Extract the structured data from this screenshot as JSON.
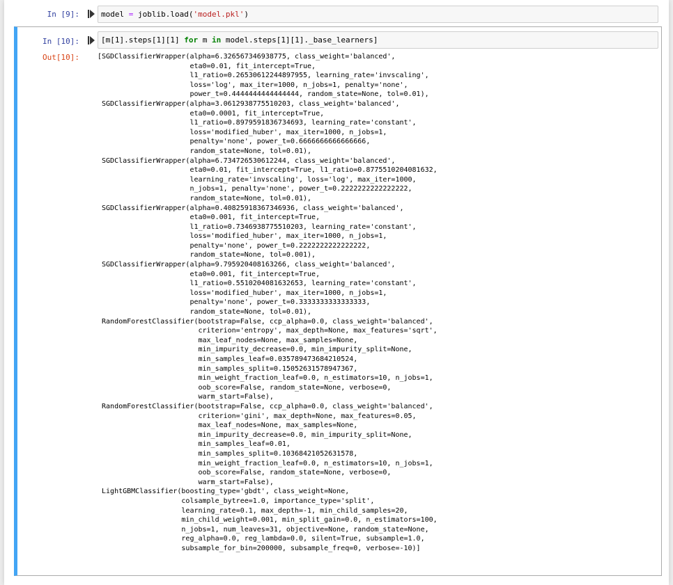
{
  "cells": [
    {
      "prompt": "In [9]:",
      "code": {
        "var": "model",
        "op": "=",
        "call": "joblib.load(",
        "arg": "'model.pkl'",
        "close": ")"
      }
    },
    {
      "prompt": "In [10]:",
      "code": {
        "open": "[m[1].steps[1][1]",
        "kw_for": "for",
        "mid": "m",
        "kw_in": "in",
        "tail": "model.steps[1][1]._base_learners]"
      },
      "output_prompt": "Out[10]:",
      "output": "[SGDClassifierWrapper(alpha=6.326567346938775, class_weight='balanced',\n                      eta0=0.01, fit_intercept=True,\n                      l1_ratio=0.26530612244897955, learning_rate='invscaling',\n                      loss='log', max_iter=1000, n_jobs=1, penalty='none',\n                      power_t=0.4444444444444444, random_state=None, tol=0.01),\n SGDClassifierWrapper(alpha=3.0612938775510203, class_weight='balanced',\n                      eta0=0.0001, fit_intercept=True,\n                      l1_ratio=0.8979591836734693, learning_rate='constant',\n                      loss='modified_huber', max_iter=1000, n_jobs=1,\n                      penalty='none', power_t=0.6666666666666666,\n                      random_state=None, tol=0.01),\n SGDClassifierWrapper(alpha=6.734726530612244, class_weight='balanced',\n                      eta0=0.01, fit_intercept=True, l1_ratio=0.8775510204081632,\n                      learning_rate='invscaling', loss='log', max_iter=1000,\n                      n_jobs=1, penalty='none', power_t=0.2222222222222222,\n                      random_state=None, tol=0.01),\n SGDClassifierWrapper(alpha=0.40825918367346936, class_weight='balanced',\n                      eta0=0.001, fit_intercept=True,\n                      l1_ratio=0.7346938775510203, learning_rate='constant',\n                      loss='modified_huber', max_iter=1000, n_jobs=1,\n                      penalty='none', power_t=0.2222222222222222,\n                      random_state=None, tol=0.001),\n SGDClassifierWrapper(alpha=9.795920408163266, class_weight='balanced',\n                      eta0=0.001, fit_intercept=True,\n                      l1_ratio=0.5510204081632653, learning_rate='constant',\n                      loss='modified_huber', max_iter=1000, n_jobs=1,\n                      penalty='none', power_t=0.3333333333333333,\n                      random_state=None, tol=0.01),\n RandomForestClassifier(bootstrap=False, ccp_alpha=0.0, class_weight='balanced',\n                        criterion='entropy', max_depth=None, max_features='sqrt',\n                        max_leaf_nodes=None, max_samples=None,\n                        min_impurity_decrease=0.0, min_impurity_split=None,\n                        min_samples_leaf=0.035789473684210524,\n                        min_samples_split=0.15052631578947367,\n                        min_weight_fraction_leaf=0.0, n_estimators=10, n_jobs=1,\n                        oob_score=False, random_state=None, verbose=0,\n                        warm_start=False),\n RandomForestClassifier(bootstrap=False, ccp_alpha=0.0, class_weight='balanced',\n                        criterion='gini', max_depth=None, max_features=0.05,\n                        max_leaf_nodes=None, max_samples=None,\n                        min_impurity_decrease=0.0, min_impurity_split=None,\n                        min_samples_leaf=0.01,\n                        min_samples_split=0.10368421052631578,\n                        min_weight_fraction_leaf=0.0, n_estimators=10, n_jobs=1,\n                        oob_score=False, random_state=None, verbose=0,\n                        warm_start=False),\n LightGBMClassifier(boosting_type='gbdt', class_weight=None,\n                    colsample_bytree=1.0, importance_type='split',\n                    learning_rate=0.1, max_depth=-1, min_child_samples=20,\n                    min_child_weight=0.001, min_split_gain=0.0, n_estimators=100,\n                    n_jobs=1, num_leaves=31, objective=None, random_state=None,\n                    reg_alpha=0.0, reg_lambda=0.0, silent=True, subsample=1.0,\n                    subsample_for_bin=200000, subsample_freq=0, verbose=-10)]"
    }
  ],
  "icons": {
    "run": "run-cell-icon"
  },
  "colors": {
    "selected_border": "#42a5f5",
    "in_prompt": "#303f9f",
    "out_prompt": "#d84315"
  }
}
